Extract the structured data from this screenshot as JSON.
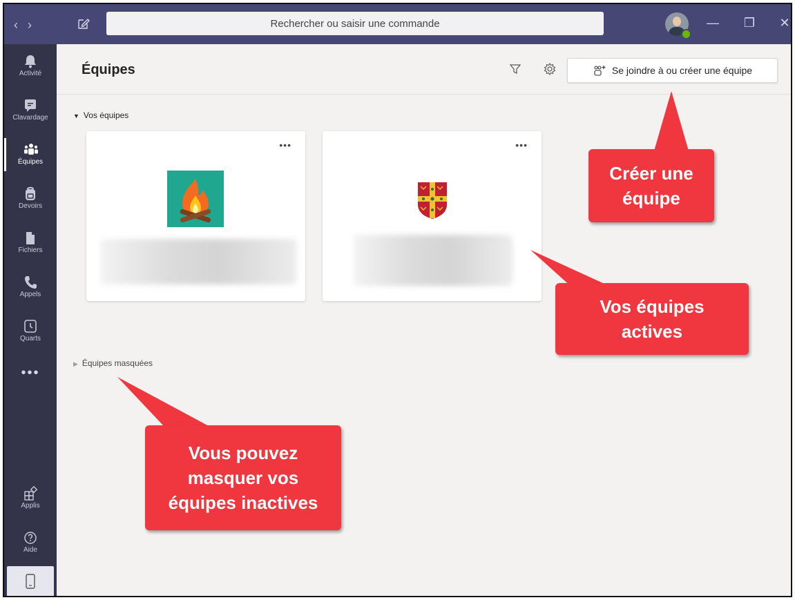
{
  "titlebar": {
    "search_placeholder": "Rechercher ou saisir une commande",
    "back_glyph": "‹",
    "forward_glyph": "›",
    "minimize_glyph": "—",
    "maximize_glyph": "❐",
    "close_glyph": "✕"
  },
  "rail": {
    "items": [
      {
        "label": "Activité",
        "icon": "bell-icon"
      },
      {
        "label": "Clavardage",
        "icon": "chat-icon"
      },
      {
        "label": "Équipes",
        "icon": "teams-icon"
      },
      {
        "label": "Devoirs",
        "icon": "backpack-icon"
      },
      {
        "label": "Fichiers",
        "icon": "file-icon"
      },
      {
        "label": "Appels",
        "icon": "phone-icon"
      },
      {
        "label": "Quarts",
        "icon": "clock-icon"
      }
    ],
    "more": "•••",
    "bottom": [
      {
        "label": "Applis",
        "icon": "apps-icon"
      },
      {
        "label": "Aide",
        "icon": "help-icon"
      }
    ]
  },
  "header": {
    "title": "Équipes",
    "join_button": "Se joindre à ou créer une équipe"
  },
  "sections": {
    "your_teams": "Vos équipes",
    "hidden_teams": "Équipes masquées"
  },
  "cards": [
    {
      "more": "•••",
      "icon": "campfire-icon"
    },
    {
      "more": "•••",
      "icon": "crest-icon"
    }
  ],
  "callouts": {
    "create": [
      "Créer une",
      "équipe"
    ],
    "active": [
      "Vos équipes",
      "actives"
    ],
    "hide": [
      "Vous pouvez",
      "masquer vos",
      "équipes inactives"
    ]
  },
  "colors": {
    "titlebar": "#464775",
    "rail": "#33344a",
    "callout": "#f0363f",
    "campfire_bg": "#1fa78f"
  }
}
